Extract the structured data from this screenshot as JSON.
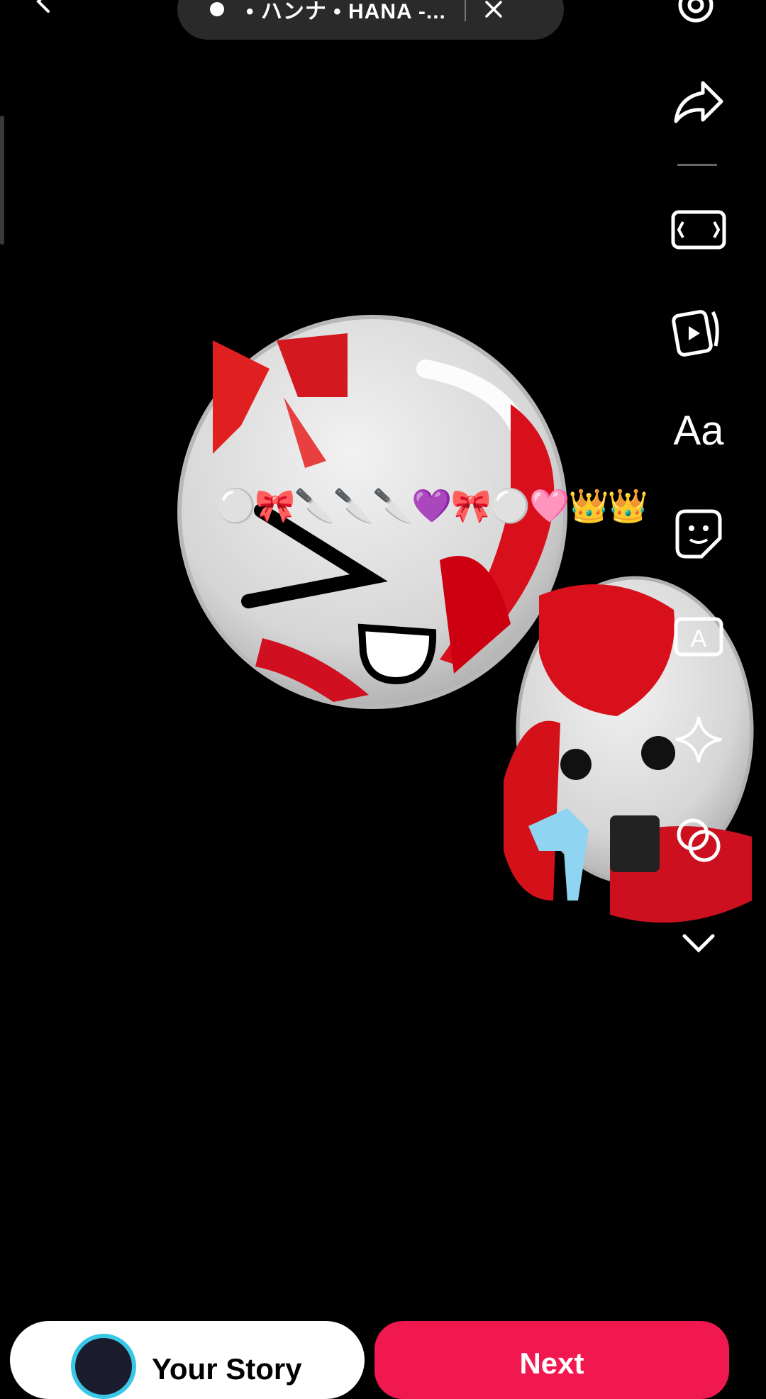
{
  "music": {
    "title": "• ハンナ • HANA -...",
    "note_icon": "music-note-icon",
    "close_icon": "close-icon"
  },
  "toolbar": {
    "text_tool_label": "Aa",
    "icons": [
      "share-icon",
      "aspect-ratio-icon",
      "clips-icon",
      "text-icon",
      "sticker-icon",
      "caption-icon",
      "effects-icon",
      "layout-icon",
      "chevron-down-icon"
    ]
  },
  "canvas": {
    "emoji_strip": "⚪🎀🔪🔪🔪💜🎀⚪🩷👑👑"
  },
  "bottom": {
    "story_label": "Your Story",
    "next_label": "Next"
  },
  "colors": {
    "accent": "#f0184f",
    "story_ring": "#39c7e6",
    "background": "#000000"
  }
}
